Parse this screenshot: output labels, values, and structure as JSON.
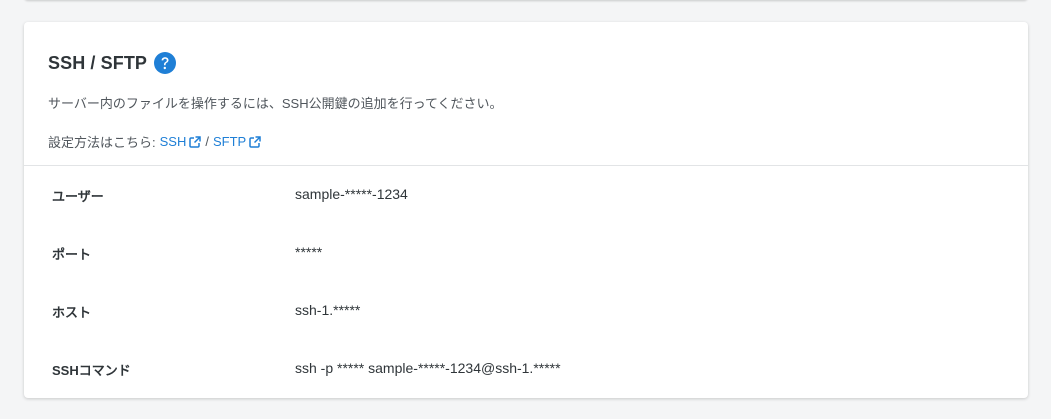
{
  "section": {
    "title": "SSH / SFTP",
    "help_icon": "question-circle-icon",
    "description": "サーバー内のファイルを操作するには、SSH公開鍵の追加を行ってください。",
    "setup_prefix": "設定方法はこちら:",
    "links": [
      {
        "label": "SSH",
        "icon": "external-link-icon"
      },
      {
        "label": "SFTP",
        "icon": "external-link-icon"
      }
    ],
    "link_separator": "/"
  },
  "rows": [
    {
      "label": "ユーザー",
      "value": "sample-*****-1234"
    },
    {
      "label": "ポート",
      "value": "*****"
    },
    {
      "label": "ホスト",
      "value": "ssh-1.*****"
    },
    {
      "label": "SSHコマンド",
      "value": "ssh -p ***** sample-*****-1234@ssh-1.*****"
    }
  ],
  "colors": {
    "accent": "#1f7fd6",
    "background": "#f4f5f6",
    "card": "#ffffff",
    "text": "#2f3539"
  }
}
